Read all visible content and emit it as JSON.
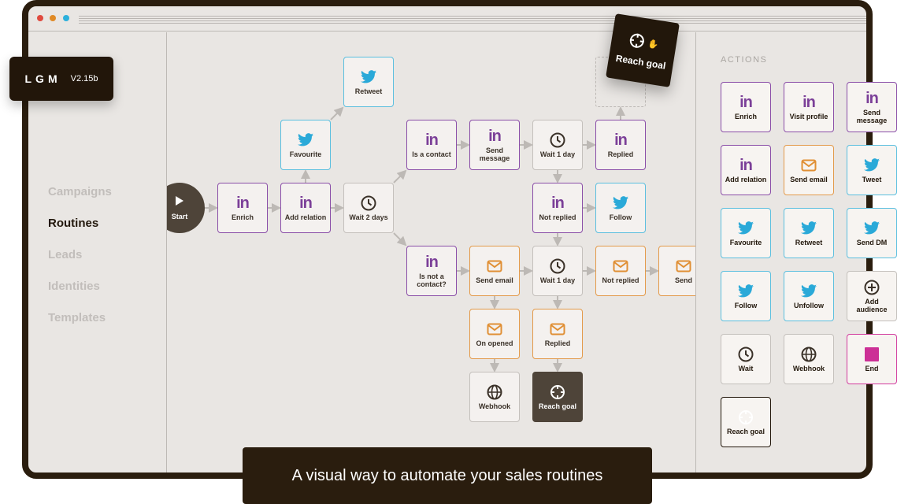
{
  "window": {
    "dots": [
      "#e04a3f",
      "#e08a25",
      "#2cb0dc"
    ]
  },
  "badge": {
    "logo": "LGM",
    "version": "V2.15b"
  },
  "sidebar": {
    "items": [
      {
        "label": "Campaigns",
        "active": false
      },
      {
        "label": "Routines",
        "active": true
      },
      {
        "label": "Leads",
        "active": false
      },
      {
        "label": "Identities",
        "active": false
      },
      {
        "label": "Templates",
        "active": false
      }
    ]
  },
  "canvas": {
    "start_label": "Start",
    "nodes": [
      {
        "label": "Retweet",
        "type": "tw"
      },
      {
        "label": "Favourite",
        "type": "tw"
      },
      {
        "label": "Is a contact",
        "type": "li"
      },
      {
        "label": "Send message",
        "type": "li"
      },
      {
        "label": "Wait 1 day",
        "type": "wait"
      },
      {
        "label": "Replied",
        "type": "li"
      },
      {
        "label": "Enrich",
        "type": "li"
      },
      {
        "label": "Add relation",
        "type": "li"
      },
      {
        "label": "Wait 2 days",
        "type": "wait"
      },
      {
        "label": "Not replied",
        "type": "li"
      },
      {
        "label": "Follow",
        "type": "tw"
      },
      {
        "label": "Is not a contact?",
        "type": "li"
      },
      {
        "label": "Send email",
        "type": "mail"
      },
      {
        "label": "Wait 1 day",
        "type": "wait"
      },
      {
        "label": "Not replied",
        "type": "mail"
      },
      {
        "label": "Send",
        "type": "mail"
      },
      {
        "label": "On opened",
        "type": "mail"
      },
      {
        "label": "Replied",
        "type": "mail"
      },
      {
        "label": "Webhook",
        "type": "webhook"
      },
      {
        "label": "Reach goal",
        "type": "goal"
      }
    ],
    "dragging": {
      "label": "Reach goal",
      "icon": "target-icon",
      "cursor": "grab-hand-icon"
    }
  },
  "actions": {
    "title": "ACTIONS",
    "items": [
      {
        "label": "Enrich",
        "type": "li"
      },
      {
        "label": "Visit profile",
        "type": "li"
      },
      {
        "label": "Send message",
        "type": "li"
      },
      {
        "label": "Add relation",
        "type": "li"
      },
      {
        "label": "Send email",
        "type": "mail"
      },
      {
        "label": "Tweet",
        "type": "tw"
      },
      {
        "label": "Favourite",
        "type": "tw"
      },
      {
        "label": "Retweet",
        "type": "tw"
      },
      {
        "label": "Send DM",
        "type": "tw"
      },
      {
        "label": "Follow",
        "type": "tw"
      },
      {
        "label": "Unfollow",
        "type": "tw"
      },
      {
        "label": "Add audience",
        "type": "audience"
      },
      {
        "label": "Wait",
        "type": "wait"
      },
      {
        "label": "Webhook",
        "type": "webhook"
      },
      {
        "label": "End",
        "type": "end"
      },
      {
        "label": "Reach goal",
        "type": "goal"
      }
    ]
  },
  "colors": {
    "linkedin": "#7b3f98",
    "twitter": "#2aa9d8",
    "email": "#e08f34",
    "end": "#cc2f96",
    "dark": "#22170b"
  },
  "banner": {
    "text": "A visual way to automate your sales routines"
  }
}
